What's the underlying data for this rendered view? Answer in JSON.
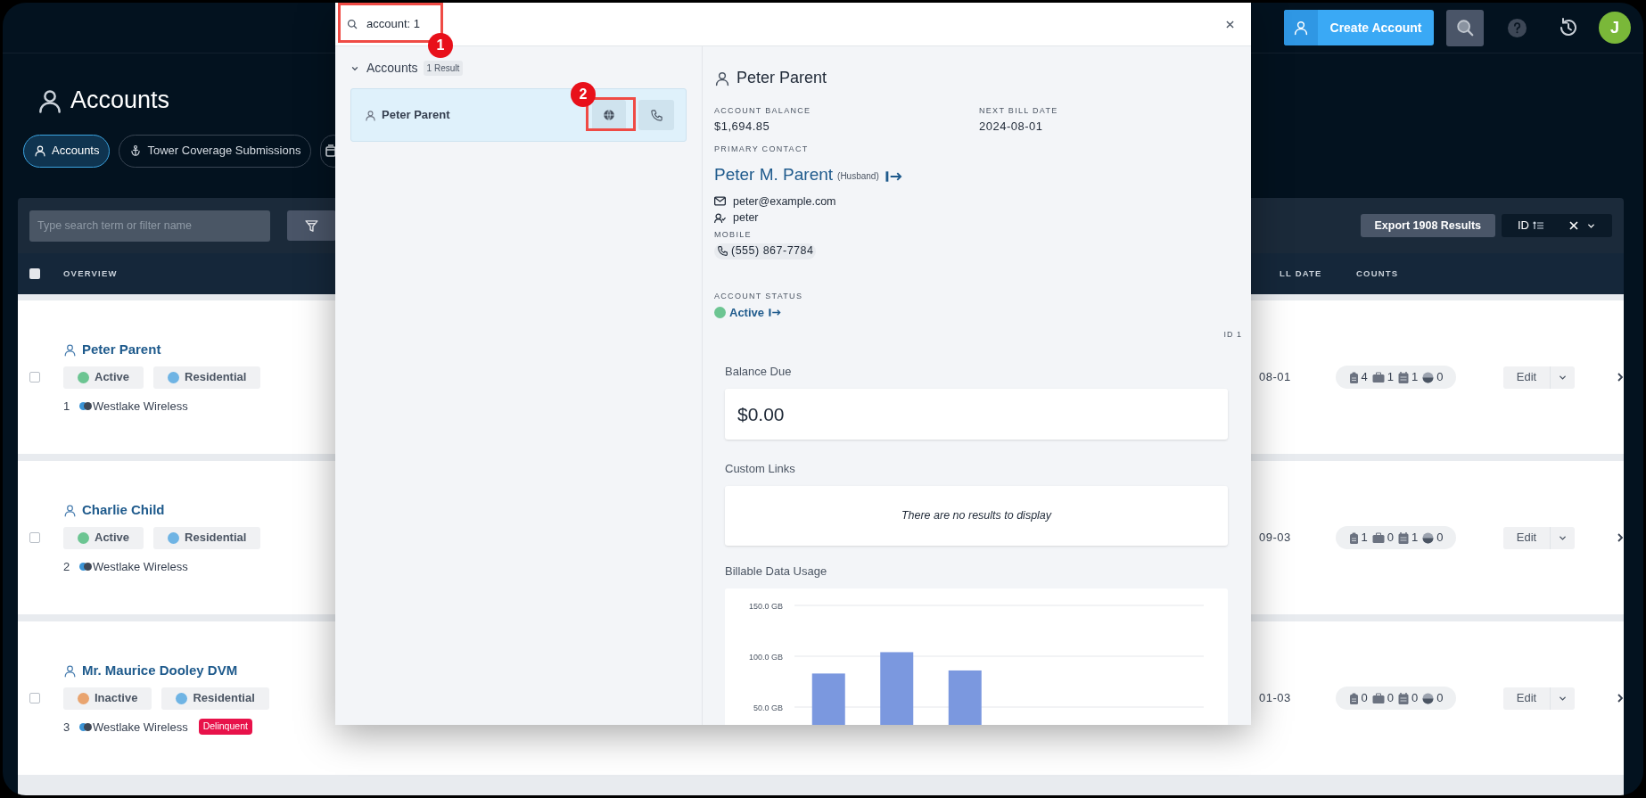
{
  "topbar": {
    "create_account": "Create Account",
    "avatar": "J"
  },
  "page": {
    "title": "Accounts"
  },
  "tabs": [
    {
      "label": "Accounts",
      "selected": true
    },
    {
      "label": "Tower Coverage Submissions",
      "selected": false
    },
    {
      "selected": false
    }
  ],
  "toolbar": {
    "search_placeholder": "Type search term or filter name",
    "export": "Export 1908 Results",
    "sort": "ID"
  },
  "table": {
    "select_all_checked": false,
    "columns": [
      "OVERVIEW",
      "LL DATE",
      "COUNTS"
    ],
    "rows": [
      {
        "checked": false,
        "name": "Peter Parent",
        "status": {
          "label": "Active",
          "color": "#6cc592"
        },
        "type": {
          "label": "Residential",
          "color": "#6fb4e4"
        },
        "id": "1",
        "company": "Westlake Wireless",
        "date": "08-01",
        "counts": [
          "4",
          "1",
          "1",
          "0"
        ],
        "edit": "Edit"
      },
      {
        "checked": false,
        "name": "Charlie Child",
        "status": {
          "label": "Active",
          "color": "#6cc592"
        },
        "type": {
          "label": "Residential",
          "color": "#6fb4e4"
        },
        "id": "2",
        "company": "Westlake Wireless",
        "date": "09-03",
        "counts": [
          "1",
          "0",
          "1",
          "0"
        ],
        "edit": "Edit"
      },
      {
        "checked": false,
        "name": "Mr. Maurice Dooley DVM",
        "status": {
          "label": "Inactive",
          "color": "#e9a46f"
        },
        "type": {
          "label": "Residential",
          "color": "#6fb4e4"
        },
        "id": "3",
        "company": "Westlake Wireless",
        "flag": "Delinquent",
        "date": "01-03",
        "counts": [
          "0",
          "0",
          "0",
          "0"
        ],
        "edit": "Edit"
      }
    ]
  },
  "search_modal": {
    "query": "account: 1",
    "group": {
      "label": "Accounts",
      "count": "1 Result",
      "expanded": true
    },
    "results": [
      {
        "name": "Peter Parent",
        "selected": true
      }
    ],
    "detail": {
      "name": "Peter Parent",
      "balance_label": "ACCOUNT BALANCE",
      "balance": "$1,694.85",
      "next_bill_label": "NEXT BILL DATE",
      "next_bill": "2024-08-01",
      "contact_label": "PRIMARY CONTACT",
      "contact_name": "Peter M. Parent",
      "contact_relation": "(Husband)",
      "email": "peter@example.com",
      "username": "peter",
      "mobile_label": "MOBILE",
      "mobile": "(555) 867-7784",
      "status_label": "ACCOUNT STATUS",
      "status": "Active",
      "id": "ID 1",
      "balance_due_title": "Balance Due",
      "balance_due": "$0.00",
      "links_title": "Custom Links",
      "links_empty": "There are no results to display",
      "usage_title": "Billable Data Usage",
      "chart_data": {
        "type": "bar",
        "values": [
          83,
          104,
          86,
          null,
          null,
          null
        ],
        "ylim": [
          0,
          150
        ],
        "yticks": [
          {
            "value": 50,
            "label": "50.0 GB"
          },
          {
            "value": 100,
            "label": "100.0 GB"
          },
          {
            "value": 150,
            "label": "150.0 GB"
          }
        ]
      }
    }
  },
  "callouts": [
    "1",
    "2"
  ]
}
